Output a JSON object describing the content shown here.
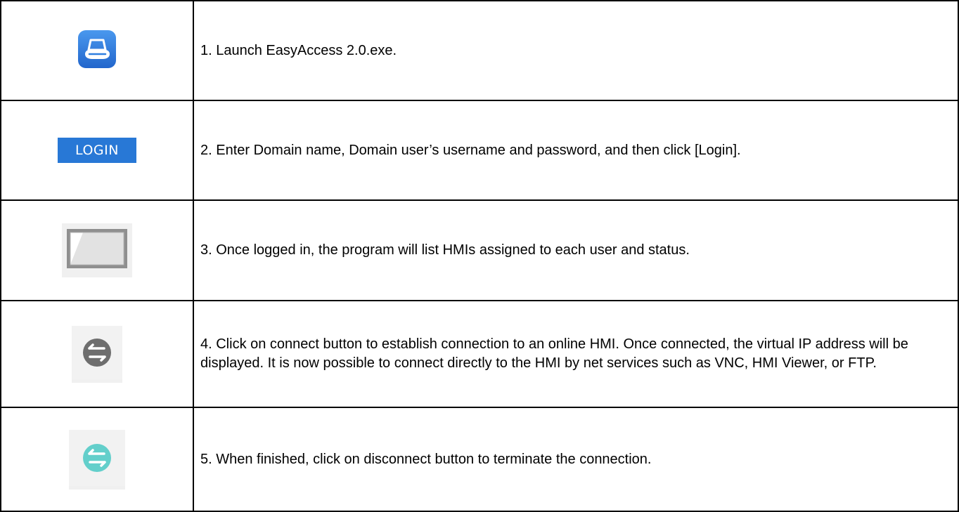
{
  "steps": [
    {
      "icon": "easyaccess-app-icon",
      "text": "1. Launch EasyAccess 2.0.exe."
    },
    {
      "icon": "login-button-icon",
      "label": "LOGIN",
      "text": "2. Enter Domain name, Domain user’s username and password, and then click [Login]."
    },
    {
      "icon": "hmi-screen-icon",
      "text": "3. Once logged in, the program will list HMIs assigned to each user and status."
    },
    {
      "icon": "connect-icon",
      "text": "4. Click on connect button to establish connection to an online HMI. Once connected, the virtual IP address will be displayed. It is now possible to connect directly to the HMI by net services such as VNC, HMI Viewer, or FTP."
    },
    {
      "icon": "disconnect-icon",
      "text": "5. When finished, click on disconnect button to terminate the connection."
    }
  ],
  "colors": {
    "app_icon_blue": "#2f7fe0",
    "login_blue": "#2878d6",
    "connect_gray": "#6e6e6e",
    "disconnect_teal": "#63cfcb"
  }
}
